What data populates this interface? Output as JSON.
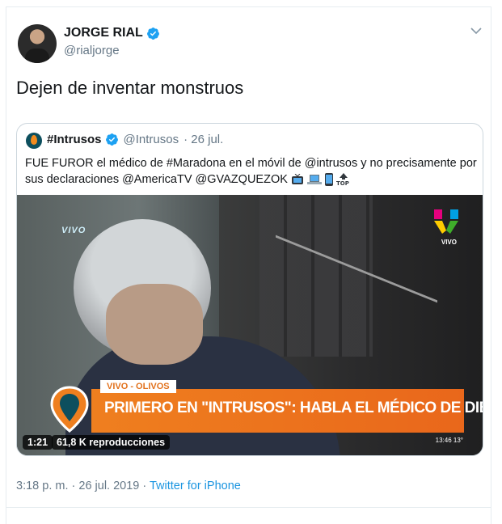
{
  "author": {
    "name": "JORGE RIAL",
    "handle": "@rialjorge",
    "verified": true,
    "avatar_icon": "avatar-jorge-rial"
  },
  "tweet": {
    "text": "Dejen de inventar monstruos"
  },
  "quoted_tweet": {
    "name": "#Intrusos",
    "handle": "@Intrusos",
    "date": "· 26 jul.",
    "text": "FUE FUROR el médico de #Maradona en el móvil de @intrusos y no precisamente por sus declaraciones @AmericaTV @GVAZQUEZOK",
    "emojis": [
      "tv-icon",
      "laptop-icon",
      "phone-icon",
      "top-arrow-icon"
    ],
    "video": {
      "duration": "1:21",
      "views": "61,8 K reproducciones",
      "overlay_top_left": "VIVO",
      "overlay_top_right": "VIVO",
      "lower_tag": "VIVO - OLIVOS",
      "banner": "PRIMERO EN \"INTRUSOS\": HABLA EL MÉDICO DE DIEGO MARADONA",
      "clock": "13:46",
      "temp": "13°"
    }
  },
  "footer": {
    "time": "3:18 p. m.",
    "date": "26 jul. 2019",
    "source": "Twitter for iPhone"
  },
  "colors": {
    "verified": "#1da1f2",
    "link": "#1b95e0",
    "meta": "#657786",
    "banner": "#ef7f1f"
  }
}
